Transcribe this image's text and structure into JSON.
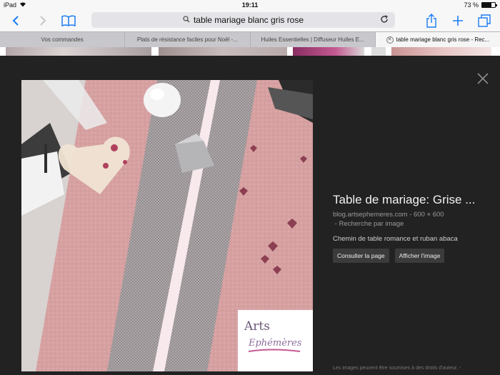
{
  "status_bar": {
    "device": "iPad",
    "time": "19:11",
    "battery": "73 %",
    "battery_level": 0.73
  },
  "toolbar": {
    "url_text": "table mariage blanc gris rose",
    "icons": [
      "back-icon",
      "forward-icon",
      "bookmarks-icon",
      "search-icon",
      "reload-icon",
      "share-icon",
      "new-tab-icon",
      "tabs-icon"
    ]
  },
  "tabs": [
    {
      "label": "Vos commandes"
    },
    {
      "label": "Plats de résistance faciles pour Noël -..."
    },
    {
      "label": "Huiles Essentielles | Diffuseur Huiles E..."
    },
    {
      "label": "table mariage blanc gris rose - Rec...",
      "active": true
    }
  ],
  "viewer": {
    "title": "Table de mariage: Grise ...",
    "source": "blog.artsephemeres.com",
    "dimensions": "600 × 600",
    "reverse_search": "Recherche par image",
    "description": "Chemin de table romance et ruban abaca",
    "buttons": {
      "visit": "Consulter la page",
      "view": "Afficher l'image"
    },
    "footnote": "Les images peuvent être soumises à des droits d'auteur. -"
  },
  "photo": {
    "logo_line1": "Arts",
    "logo_line2": "Ephémères"
  },
  "colors": {
    "accent": "#1a7cf5",
    "viewer_bg": "#222222",
    "tablecloth": "#d9a3a3",
    "runner": "#8d8689"
  }
}
